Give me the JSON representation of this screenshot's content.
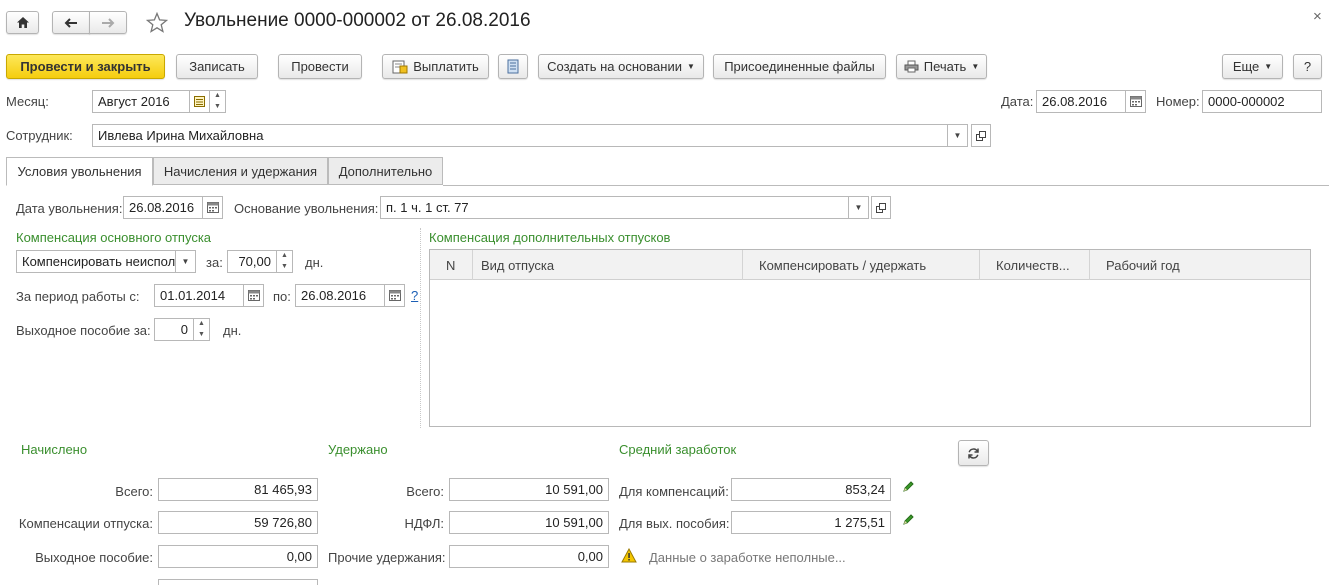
{
  "window": {
    "title": "Увольнение 0000-000002 от 26.08.2016"
  },
  "toolbar": {
    "post_close": "Провести и закрыть",
    "write": "Записать",
    "post": "Провести",
    "pay": "Выплатить",
    "create_based": "Создать на основании",
    "attached": "Присоединенные файлы",
    "print": "Печать",
    "more": "Еще",
    "help": "?"
  },
  "header": {
    "month_label": "Месяц:",
    "month_value": "Август 2016",
    "date_label": "Дата:",
    "date_value": "26.08.2016",
    "number_label": "Номер:",
    "number_value": "0000-000002",
    "employee_label": "Сотрудник:",
    "employee_value": "Ивлева Ирина Михайловна"
  },
  "tabs": [
    "Условия увольнения",
    "Начисления и удержания",
    "Дополнительно"
  ],
  "conditions": {
    "dismissal_date_label": "Дата увольнения:",
    "dismissal_date": "26.08.2016",
    "basis_label": "Основание увольнения:",
    "basis_value": "п. 1 ч. 1 ст. 77"
  },
  "main_comp": {
    "title": "Компенсация основного отпуска",
    "mode": "Компенсировать неиспол",
    "for_label": "за:",
    "days": "70,00",
    "days_unit": "дн.",
    "period_label": "За период работы с:",
    "period_from": "01.01.2014",
    "to_label": "по:",
    "period_to": "26.08.2016",
    "help": "?",
    "severance_label": "Выходное пособие за:",
    "severance_days": "0",
    "severance_unit": "дн."
  },
  "extra_comp": {
    "title": "Компенсация дополнительных отпусков",
    "columns": [
      "N",
      "Вид отпуска",
      "Компенсировать / удержать",
      "Количеств...",
      "Рабочий год"
    ]
  },
  "accrued": {
    "title": "Начислено",
    "total_label": "Всего:",
    "total": "81 465,93",
    "vac_label": "Компенсации отпуска:",
    "vac": "59 726,80",
    "sev_label": "Выходное пособие:",
    "sev": "0,00"
  },
  "withheld": {
    "title": "Удержано",
    "total_label": "Всего:",
    "total": "10 591,00",
    "ndfl_label": "НДФЛ:",
    "ndfl": "10 591,00",
    "other_label": "Прочие удержания:",
    "other": "0,00"
  },
  "avg": {
    "title": "Средний заработок",
    "comp_label": "Для компенсаций:",
    "comp": "853,24",
    "sev_label": "Для вых. пособия:",
    "sev": "1 275,51",
    "warning": "Данные о заработке неполные..."
  },
  "colors": {
    "primary": "#f5cd0e",
    "section_title": "#3a8f2e",
    "pencil": "#3c9a2a",
    "warning": "#e2b400"
  }
}
